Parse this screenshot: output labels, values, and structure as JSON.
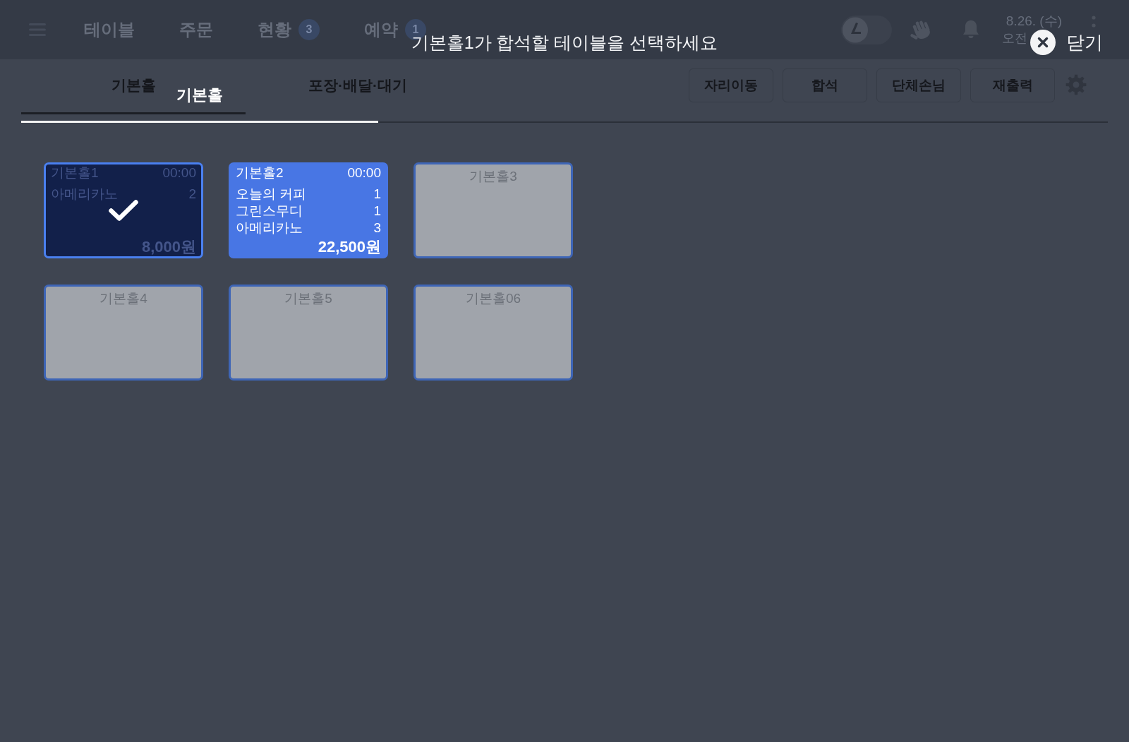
{
  "top_bar": {
    "nav": [
      {
        "label": "테이블"
      },
      {
        "label": "주문"
      },
      {
        "label": "현황",
        "badge": "3"
      },
      {
        "label": "예약",
        "badge": "1"
      }
    ],
    "toggle": {
      "on": false
    },
    "date": "8.26. (수)",
    "time": "오전"
  },
  "hall_tabs": [
    {
      "label": "기본홀",
      "selected": true
    },
    {
      "label": "포장·배달·대기",
      "selected": false
    }
  ],
  "actions": [
    "자리이동",
    "합석",
    "단체손님",
    "재출력"
  ],
  "dialog": {
    "title": "기본홀1가 합석할 테이블을 선택하세요",
    "close_label": "닫기",
    "tabs": [
      {
        "label": "기본홀",
        "selected": true
      }
    ],
    "tables": [
      {
        "kind": "occupied",
        "name": "기본홀1",
        "time": "00:00",
        "items": [
          {
            "name": "아메리카노",
            "qty": "2"
          }
        ],
        "total": "8,000원",
        "selected": true
      },
      {
        "kind": "occupied",
        "name": "기본홀2",
        "time": "00:00",
        "items": [
          {
            "name": "오늘의 커피",
            "qty": "1"
          },
          {
            "name": "그린스무디",
            "qty": "1"
          },
          {
            "name": "아메리카노",
            "qty": "3"
          }
        ],
        "total": "22,500원",
        "selected": false
      },
      {
        "kind": "empty",
        "name": "기본홀3",
        "selected": false
      },
      {
        "kind": "empty",
        "name": "기본홀4",
        "selected": false
      },
      {
        "kind": "empty",
        "name": "기본홀5",
        "selected": false
      },
      {
        "kind": "empty",
        "name": "기본홀06",
        "selected": false
      }
    ]
  }
}
